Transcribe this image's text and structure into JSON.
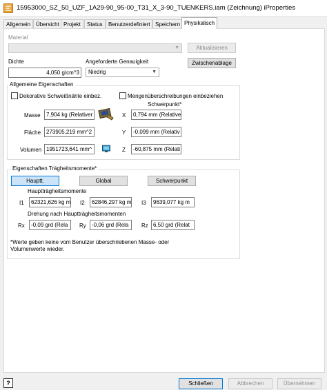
{
  "window": {
    "title": "15953000_SZ_50_UZF_1A29-90_95-00_T31_X_3-90_TUENKERS.iam (Zeichnung) iProperties"
  },
  "tabs": [
    {
      "label": "Allgemein",
      "active": false
    },
    {
      "label": "Übersicht",
      "active": false
    },
    {
      "label": "Projekt",
      "active": false
    },
    {
      "label": "Status",
      "active": false
    },
    {
      "label": "Benutzerdefiniert",
      "active": false
    },
    {
      "label": "Speichern",
      "active": false
    },
    {
      "label": "Physikalisch",
      "active": true
    }
  ],
  "material": {
    "label": "Material",
    "value": "",
    "update_button": "Aktualisieren"
  },
  "density": {
    "label": "Dichte",
    "value": "4,050 g/cm^3"
  },
  "accuracy": {
    "label": "Angeforderte Genauigkeit",
    "value": "Niedrig"
  },
  "clipboard_button": "Zwischenablage",
  "general": {
    "title": "Allgemeine Eigenschaften",
    "decorative_welds": "Dekorative Schweißnähte einbez.",
    "decorative_welds_checked": false,
    "quantity_overrides": "Mengenüberschreibungen einbeziehen",
    "quantity_overrides_checked": false,
    "mass_label": "Masse",
    "mass_value": "7,904 kg (Relativer",
    "area_label": "Fläche",
    "area_value": "273905,219 mm^2",
    "volume_label": "Volumen",
    "volume_value": "1951723,641 mm^",
    "cog_label": "Schwerpunkt*",
    "x_label": "X",
    "x_value": "0,794 mm (Relative",
    "y_label": "Y",
    "y_value": "-0,099 mm (Relativ",
    "z_label": "Z",
    "z_value": "-60,875 mm (Relati"
  },
  "inertia": {
    "title": "Eigenschaften Trägheitsmomente*",
    "btn_principal": "Hauptt.",
    "btn_global": "Global",
    "btn_cog": "Schwerpunkt",
    "principal_moments_label": "Hauptträgheitsmomente",
    "i1_label": "I1",
    "i1_value": "62321,626 kg m",
    "i2_label": "I2",
    "i2_value": "62846,297 kg m",
    "i3_label": "I3",
    "i3_value": "9639,077 kg m",
    "rotation_label": "Drehung nach Hauptträgheitsmomenten",
    "rx_label": "Rx",
    "rx_value": "-0,09 grd (Rela",
    "ry_label": "Ry",
    "ry_value": "-0,06 grd (Rela",
    "rz_label": "Rz",
    "rz_value": "6,50 grd (Relat"
  },
  "footnote_line1": "*Werte geben keine vom Benutzer überschriebenen Masse- oder",
  "footnote_line2": "Volumenwerte wieder.",
  "buttons": {
    "close": "Schließen",
    "cancel": "Abbrechen",
    "apply": "Übernehmen"
  },
  "help_icon_char": "?"
}
